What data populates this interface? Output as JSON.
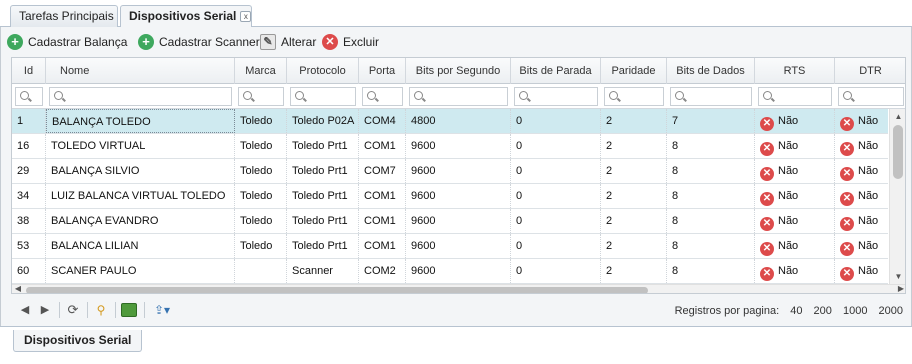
{
  "tabs": [
    {
      "label": "Tarefas Principais"
    },
    {
      "label": "Dispositivos Serial",
      "close": "x"
    }
  ],
  "toolbar": {
    "add_scale": "Cadastrar Balança",
    "add_scanner": "Cadastrar Scanner",
    "edit": "Alterar",
    "delete": "Excluir"
  },
  "grid": {
    "columns": [
      "Id",
      "Nome",
      "Marca",
      "Protocolo",
      "Porta",
      "Bits por Segundo",
      "Bits de Parada",
      "Paridade",
      "Bits de Dados",
      "RTS",
      "DTR"
    ],
    "rows": [
      [
        "1",
        "BALANÇA TOLEDO",
        "Toledo",
        "Toledo P02A",
        "COM4",
        "4800",
        "0",
        "2",
        "7",
        "Não",
        "Não"
      ],
      [
        "16",
        "TOLEDO VIRTUAL",
        "Toledo",
        "Toledo Prt1",
        "COM1",
        "9600",
        "0",
        "2",
        "8",
        "Não",
        "Não"
      ],
      [
        "29",
        "BALANÇA SILVIO",
        "Toledo",
        "Toledo Prt1",
        "COM7",
        "9600",
        "0",
        "2",
        "8",
        "Não",
        "Não"
      ],
      [
        "34",
        "LUIZ BALANCA VIRTUAL TOLEDO",
        "Toledo",
        "Toledo Prt1",
        "COM1",
        "9600",
        "0",
        "2",
        "8",
        "Não",
        "Não"
      ],
      [
        "38",
        "BALANÇA EVANDRO",
        "Toledo",
        "Toledo Prt1",
        "COM1",
        "9600",
        "0",
        "2",
        "8",
        "Não",
        "Não"
      ],
      [
        "53",
        "BALANCA LILIAN",
        "Toledo",
        "Toledo Prt1",
        "COM1",
        "9600",
        "0",
        "2",
        "8",
        "Não",
        "Não"
      ],
      [
        "60",
        "SCANER PAULO",
        "",
        "Scanner",
        "COM2",
        "9600",
        "0",
        "2",
        "8",
        "Não",
        "Não"
      ]
    ],
    "selected_row": 0
  },
  "pager": {
    "label": "Registros por pagina:",
    "options": [
      "40",
      "200",
      "1000",
      "2000"
    ]
  },
  "bottom_tab": {
    "label": "Dispositivos Serial"
  },
  "icons": {
    "add": "plus-circle-icon",
    "edit": "pencil-icon",
    "delete": "x-circle-icon",
    "filter": "magnifier-icon",
    "bool_false": "x-circle-icon"
  },
  "colors": {
    "selected_row": "#cfeaf0",
    "add_icon": "#3ea85e",
    "delete_icon": "#dd4b4b"
  }
}
